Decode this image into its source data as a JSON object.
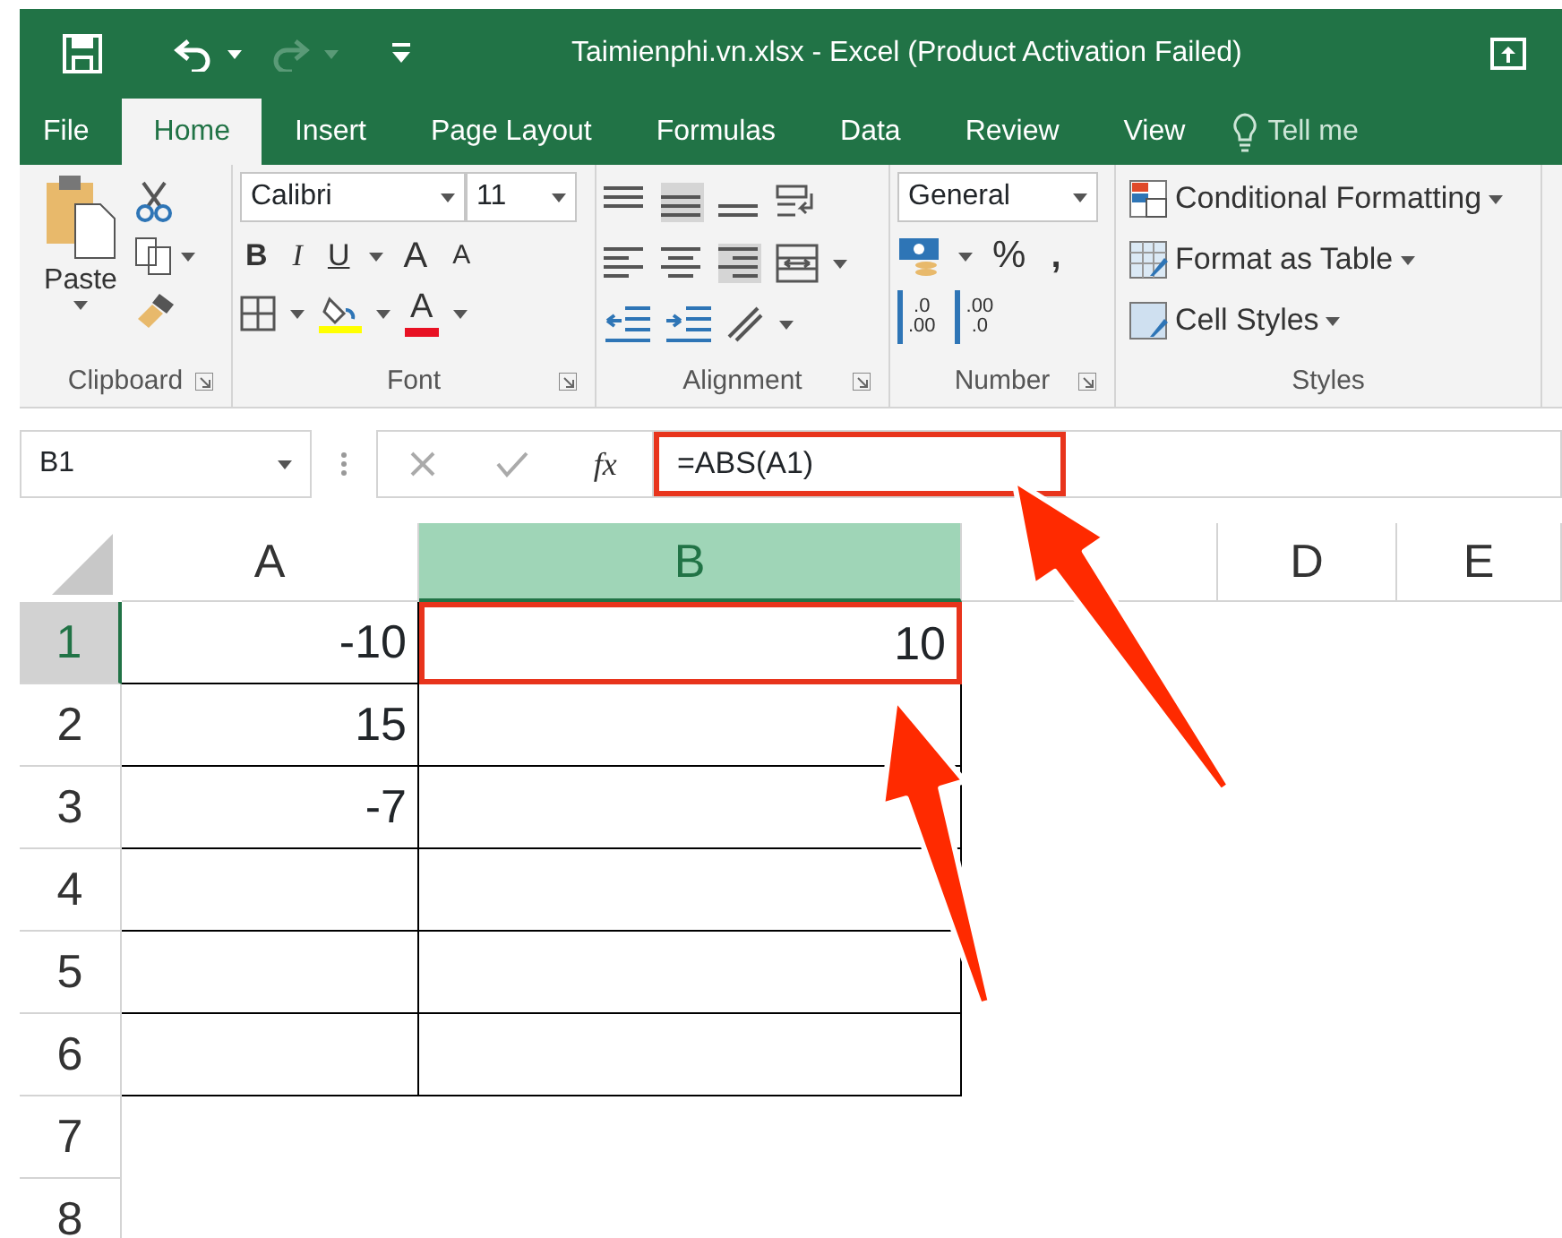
{
  "title_bar": {
    "title": "Taimienphi.vn.xlsx - Excel (Product Activation Failed)"
  },
  "tabs": [
    {
      "label": "File",
      "selected": false
    },
    {
      "label": "Home",
      "selected": true
    },
    {
      "label": "Insert",
      "selected": false
    },
    {
      "label": "Page Layout",
      "selected": false
    },
    {
      "label": "Formulas",
      "selected": false
    },
    {
      "label": "Data",
      "selected": false
    },
    {
      "label": "Review",
      "selected": false
    },
    {
      "label": "View",
      "selected": false
    }
  ],
  "tell_me": "Tell me",
  "ribbon": {
    "clipboard": {
      "paste": "Paste",
      "group": "Clipboard"
    },
    "font": {
      "name": "Calibri",
      "size": "11",
      "bold": "B",
      "italic": "I",
      "underline": "U",
      "grow": "A",
      "shrink": "A",
      "font_color": "A",
      "group": "Font"
    },
    "alignment": {
      "group": "Alignment"
    },
    "number": {
      "format": "General",
      "percent": "%",
      "comma": ",",
      "decimals": [
        {
          "top": ".0",
          "bottom": ".00"
        },
        {
          "top": ".00",
          "bottom": ".0"
        }
      ],
      "group": "Number"
    },
    "styles": {
      "items": [
        "Conditional Formatting",
        "Format as Table",
        "Cell Styles"
      ],
      "group": "Styles"
    }
  },
  "formula_bar": {
    "name_box": "B1",
    "fx": "fx",
    "formula": "=ABS(A1)",
    "highlighted": true
  },
  "sheet": {
    "columns": [
      {
        "label": "A",
        "selected": false
      },
      {
        "label": "B",
        "selected": true
      },
      {
        "selected": false
      },
      {
        "label": "D",
        "selected": false
      },
      {
        "label": "E",
        "selected": false
      }
    ],
    "rows": [
      {
        "label": "1",
        "selected": true,
        "bordered": true,
        "cells": [
          {
            "value": "-10",
            "active": false
          },
          {
            "value": "10",
            "active": true
          }
        ]
      },
      {
        "label": "2",
        "selected": false,
        "bordered": true,
        "cells": [
          {
            "value": "15",
            "active": false
          }
        ]
      },
      {
        "label": "3",
        "selected": false,
        "bordered": true,
        "cells": [
          {
            "value": "-7",
            "active": false
          }
        ]
      },
      {
        "label": "4",
        "selected": false,
        "bordered": true,
        "cells": []
      },
      {
        "label": "5",
        "selected": false,
        "bordered": true,
        "cells": []
      },
      {
        "label": "6",
        "selected": false,
        "bordered": true,
        "cells": []
      },
      {
        "label": "7",
        "selected": false,
        "bordered": false,
        "cells": []
      },
      {
        "label": "8",
        "selected": false,
        "bordered": false,
        "cells": []
      }
    ]
  }
}
